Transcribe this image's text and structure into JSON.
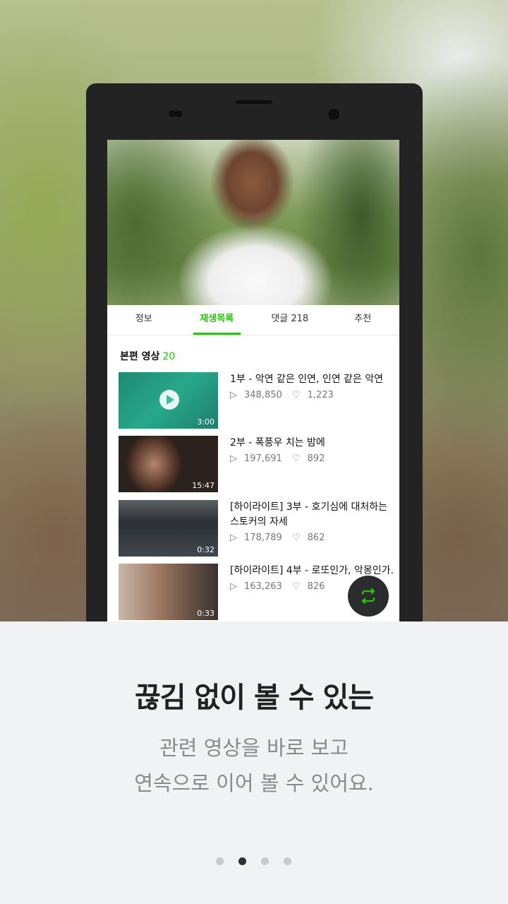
{
  "tabs": [
    "정보",
    "재생목록",
    "댓글 218",
    "추천"
  ],
  "section": {
    "title": "본편 영상",
    "count": "20"
  },
  "videos": [
    {
      "title": "1부 - 악연 같은 인연, 인연 같은 악연",
      "plays": "348,850",
      "likes": "1,223",
      "duration": "3:00"
    },
    {
      "title": "2부 - 폭풍우 치는 밤에",
      "plays": "197,691",
      "likes": "892",
      "duration": "15:47"
    },
    {
      "title": "[하이라이트] 3부 - 호기심에 대처하는 스토커의 자세",
      "plays": "178,789",
      "likes": "862",
      "duration": "0:32"
    },
    {
      "title": "[하이라이트] 4부 - 로또인가, 악몽인가.",
      "plays": "163,263",
      "likes": "826",
      "duration": "0:33"
    }
  ],
  "headline": "끊김 없이 볼 수 있는",
  "subtitle_line1": "관련 영상을 바로 보고",
  "subtitle_line2": "연속으로 이어 볼 수 있어요.",
  "icons": {
    "play": "play-icon",
    "like": "heart-icon",
    "repeat": "repeat-icon"
  },
  "colors": {
    "accent": "#1ec800",
    "fab": "#2b2c2e"
  },
  "pagination": {
    "current": 2,
    "total": 4
  }
}
